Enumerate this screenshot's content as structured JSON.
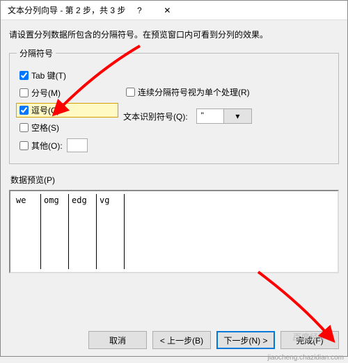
{
  "titlebar": {
    "title": "文本分列向导 - 第 2 步，共 3 步"
  },
  "description": "请设置分列数据所包含的分隔符号。在预览窗口内可看到分列的效果。",
  "group_delimiters": {
    "legend": "分隔符号"
  },
  "delimiters": {
    "tab": {
      "label": "Tab 键(T)",
      "checked": true
    },
    "semi": {
      "label": "分号(M)",
      "checked": false
    },
    "comma": {
      "label": "逗号(C)",
      "checked": true
    },
    "space": {
      "label": "空格(S)",
      "checked": false
    },
    "other": {
      "label": "其他(O):",
      "checked": false,
      "value": ""
    }
  },
  "treat_consecutive": {
    "label": "连续分隔符号视为单个处理(R)",
    "checked": false
  },
  "text_qualifier": {
    "label": "文本识别符号(Q):",
    "value": "\""
  },
  "preview_label": "数据预览(P)",
  "preview_columns": [
    "we",
    "omg",
    "edg",
    "vg"
  ],
  "buttons": {
    "cancel": "取消",
    "back": "< 上一步(B)",
    "next": "下一步(N) >",
    "finish": "完成(F)"
  },
  "watermark": "百度经验",
  "footer_url": "jiaocheng.chazidian.com",
  "annotation_target_next": true
}
